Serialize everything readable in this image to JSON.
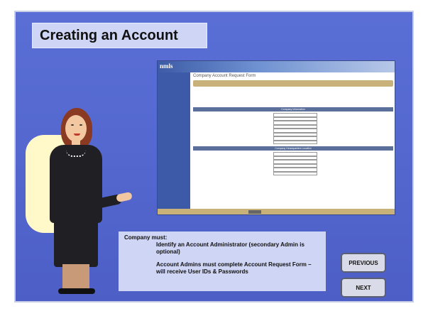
{
  "slide": {
    "title": "Creating an Account",
    "note": {
      "heading": "Company must:",
      "items": [
        "Identify an Account Administrator (secondary Admin is optional)",
        "Account Admins must complete Account Request Form – will receive User IDs & Passwords"
      ]
    },
    "nav": {
      "previous": "PREVIOUS",
      "next": "NEXT"
    }
  },
  "embedded_screenshot": {
    "logo": "nmls",
    "form_title": "Company Account Request Form",
    "sections": [
      "Company Information",
      "Company Headquarters Location"
    ]
  },
  "colors": {
    "slide_background": "#5468d0",
    "title_box": "#cfd5f4",
    "form_banner": "#c9b27a"
  }
}
